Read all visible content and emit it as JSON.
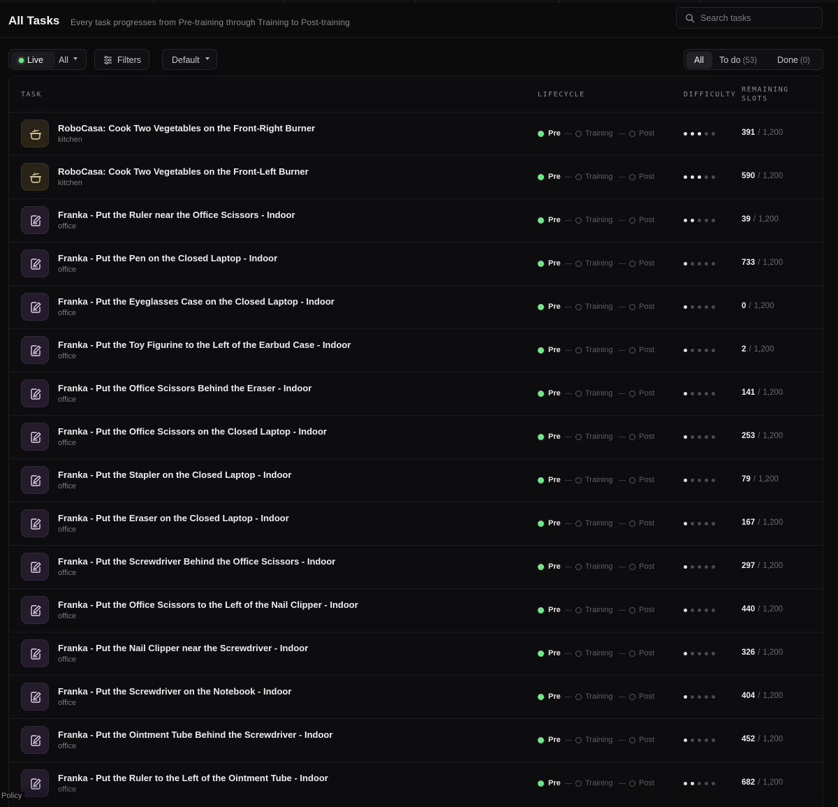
{
  "header": {
    "title": "All Tasks",
    "subtitle": "Every task progresses from Pre-training through Training to Post-training",
    "search_placeholder": "Search tasks"
  },
  "toolbar": {
    "live_label": "Live",
    "scope_label": "All",
    "filters_label": "Filters",
    "sort_label": "Default",
    "tabs": [
      {
        "label": "All",
        "count": ""
      },
      {
        "label": "To do",
        "count": "(53)"
      },
      {
        "label": "Done",
        "count": "(0)"
      }
    ]
  },
  "columns": {
    "task": "TASK",
    "lifecycle": "LIFECYCLE",
    "difficulty": "DIFFICULTY",
    "remaining_line1": "REMAINING",
    "remaining_line2": "SLOTS"
  },
  "lifecycle_labels": {
    "pre": "Pre",
    "training": "Training",
    "post": "Post"
  },
  "colors": {
    "accent_green": "#6ee787",
    "kitchen_icon_bg": "#2a2418",
    "office_icon_bg": "#241c2b"
  },
  "tasks": [
    {
      "name": "RoboCasa: Cook Two Vegetables on the Front-Right Burner",
      "category": "kitchen",
      "icon": "pot-icon",
      "difficulty": 3,
      "used": "391",
      "total": "1,200"
    },
    {
      "name": "RoboCasa: Cook Two Vegetables on the Front-Left Burner",
      "category": "kitchen",
      "icon": "pot-icon",
      "difficulty": 3,
      "used": "590",
      "total": "1,200"
    },
    {
      "name": "Franka - Put the Ruler near the Office Scissors - Indoor",
      "category": "office",
      "icon": "note-pen-icon",
      "difficulty": 2,
      "used": "39",
      "total": "1,200"
    },
    {
      "name": "Franka - Put the Pen on the Closed Laptop - Indoor",
      "category": "office",
      "icon": "note-pen-icon",
      "difficulty": 1,
      "used": "733",
      "total": "1,200"
    },
    {
      "name": "Franka - Put the Eyeglasses Case on the Closed Laptop - Indoor",
      "category": "office",
      "icon": "note-pen-icon",
      "difficulty": 1,
      "used": "0",
      "total": "1,200"
    },
    {
      "name": "Franka - Put the Toy Figurine to the Left of the Earbud Case - Indoor",
      "category": "office",
      "icon": "note-pen-icon",
      "difficulty": 1,
      "used": "2",
      "total": "1,200"
    },
    {
      "name": "Franka - Put the Office Scissors Behind the Eraser - Indoor",
      "category": "office",
      "icon": "note-pen-icon",
      "difficulty": 1,
      "used": "141",
      "total": "1,200"
    },
    {
      "name": "Franka - Put the Office Scissors on the Closed Laptop - Indoor",
      "category": "office",
      "icon": "note-pen-icon",
      "difficulty": 1,
      "used": "253",
      "total": "1,200"
    },
    {
      "name": "Franka - Put the Stapler on the Closed Laptop - Indoor",
      "category": "office",
      "icon": "note-pen-icon",
      "difficulty": 1,
      "used": "79",
      "total": "1,200"
    },
    {
      "name": "Franka - Put the Eraser on the Closed Laptop - Indoor",
      "category": "office",
      "icon": "note-pen-icon",
      "difficulty": 1,
      "used": "167",
      "total": "1,200"
    },
    {
      "name": "Franka - Put the Screwdriver Behind the Office Scissors - Indoor",
      "category": "office",
      "icon": "note-pen-icon",
      "difficulty": 1,
      "used": "297",
      "total": "1,200"
    },
    {
      "name": "Franka - Put the Office Scissors to the Left of the Nail Clipper - Indoor",
      "category": "office",
      "icon": "note-pen-icon",
      "difficulty": 1,
      "used": "440",
      "total": "1,200"
    },
    {
      "name": "Franka - Put the Nail Clipper near the Screwdriver - Indoor",
      "category": "office",
      "icon": "note-pen-icon",
      "difficulty": 1,
      "used": "326",
      "total": "1,200"
    },
    {
      "name": "Franka - Put the Screwdriver on the Notebook - Indoor",
      "category": "office",
      "icon": "note-pen-icon",
      "difficulty": 1,
      "used": "404",
      "total": "1,200"
    },
    {
      "name": "Franka - Put the Ointment Tube Behind the Screwdriver - Indoor",
      "category": "office",
      "icon": "note-pen-icon",
      "difficulty": 1,
      "used": "452",
      "total": "1,200"
    },
    {
      "name": "Franka - Put the Ruler to the Left of the Ointment Tube - Indoor",
      "category": "office",
      "icon": "note-pen-icon",
      "difficulty": 2,
      "used": "682",
      "total": "1,200"
    }
  ],
  "footer": {
    "policy_label": "Policy"
  }
}
